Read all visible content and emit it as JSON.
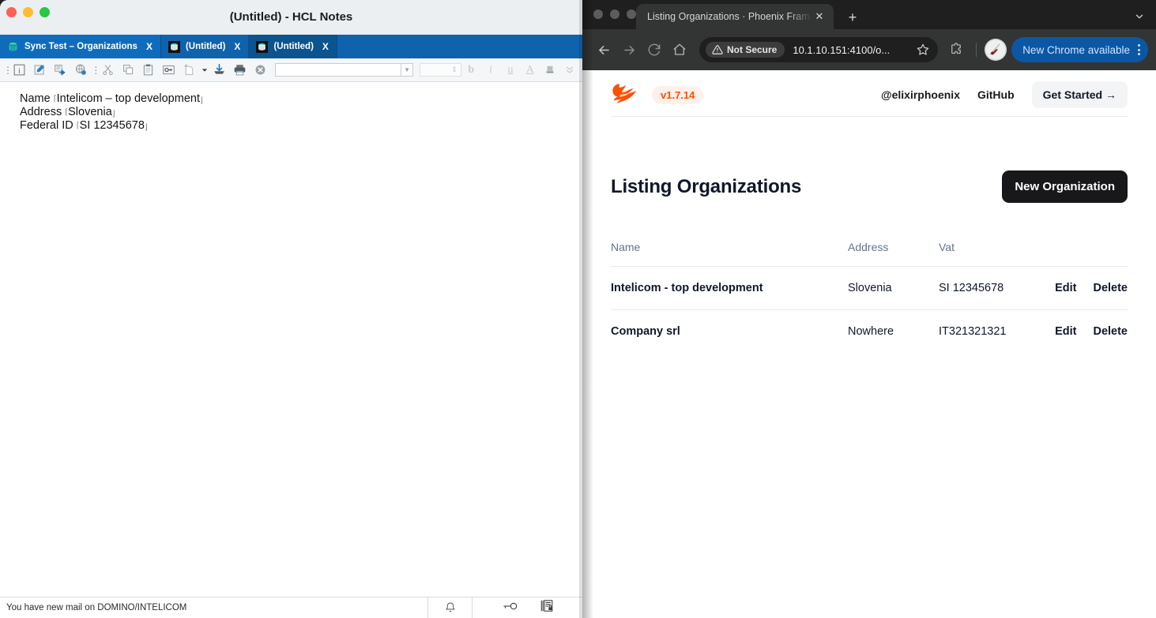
{
  "notes_window": {
    "title": "(Untitled) - HCL Notes",
    "traffic_lights": [
      "close",
      "minimize",
      "maximize"
    ],
    "tabs": [
      {
        "label": "Sync Test – Organizations",
        "icon": "notes-database-icon",
        "state": "active",
        "close": "X"
      },
      {
        "label": "(Untitled)",
        "icon": "notes-document-icon",
        "state": "inactive",
        "close": "X"
      },
      {
        "label": "(Untitled)",
        "icon": "notes-document-icon",
        "state": "selected",
        "close": "X"
      }
    ],
    "toolbar": {
      "icons": [
        "properties-icon",
        "edit-document-icon",
        "forward-icon",
        "globe-bug-icon",
        "cut-icon",
        "copy-icon",
        "paste-icon",
        "link-icon",
        "new-document-icon",
        "dropdown-arrow-icon",
        "import-icon",
        "print-icon",
        "delete-icon"
      ],
      "font_combo_value": "",
      "font_size_value": "",
      "format_buttons": [
        "bold",
        "italic",
        "underline",
        "font-color",
        "highlight",
        "more"
      ]
    },
    "document": {
      "fields": [
        {
          "label": "Name",
          "value": "Intelicom – top development"
        },
        {
          "label": "Address",
          "value": "Slovenia"
        },
        {
          "label": "Federal ID",
          "value": "SI 12345678"
        }
      ],
      "field_open_marker": "⌈",
      "field_close_marker": "⌋"
    },
    "status_bar": {
      "message": "You have new mail on DOMINO/INTELICOM",
      "icons": [
        "bell-icon",
        "key-icon",
        "document-lock-icon"
      ]
    }
  },
  "chrome_window": {
    "traffic_lights": [
      "close",
      "minimize",
      "maximize"
    ],
    "tab": {
      "title": "Listing Organizations · Phoenix Framework",
      "close": "✕"
    },
    "new_tab_label": "+",
    "tab_search_icon": "chevron-down-icon",
    "toolbar": {
      "back_icon": "arrow-left-icon",
      "forward_icon": "arrow-right-icon",
      "reload_icon": "reload-icon",
      "home_icon": "home-icon",
      "security_label": "Not Secure",
      "url": "10.1.10.151:4100/o...",
      "bookmark_icon": "star-icon",
      "extensions_icon": "puzzle-piece-icon",
      "profile_icon": "profile-avatar-icon",
      "update_label": "New Chrome available",
      "menu_icon": "kebab-menu-icon"
    }
  },
  "page": {
    "header": {
      "logo": "phoenix-bird-logo",
      "version": "v1.7.14",
      "links": [
        {
          "label": "@elixirphoenix"
        },
        {
          "label": "GitHub"
        }
      ],
      "cta": "Get Started →"
    },
    "title": "Listing Organizations",
    "primary_action": "New Organization",
    "table": {
      "columns": [
        "Name",
        "Address",
        "Vat",
        ""
      ],
      "rows": [
        {
          "name": "Intelicom - top development",
          "address": "Slovenia",
          "vat": "SI 12345678",
          "edit": "Edit",
          "delete": "Delete"
        },
        {
          "name": "Company srl",
          "address": "Nowhere",
          "vat": "IT321321321",
          "edit": "Edit",
          "delete": "Delete"
        }
      ]
    }
  },
  "colors": {
    "notes_tab_blue": "#0f62ac",
    "notes_tab_active": "#0f6cbd",
    "phoenix_orange": "#fd4f00",
    "chrome_dark": "#1f1f1f",
    "chrome_toolbar": "#333434",
    "chrome_update_blue": "#0b57a4",
    "button_black": "#18181b"
  }
}
